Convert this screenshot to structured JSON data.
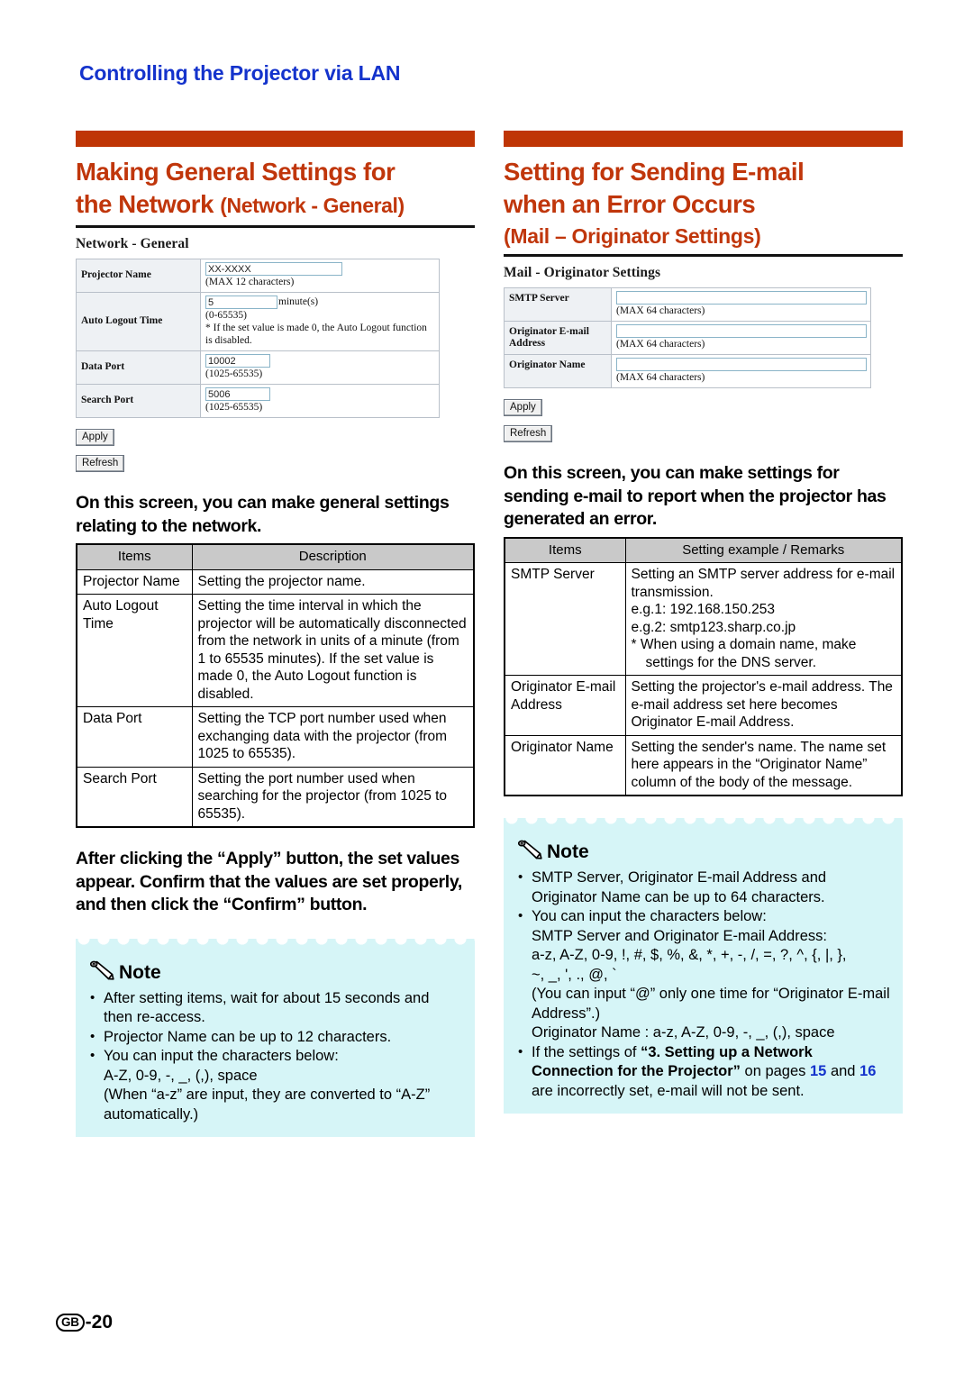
{
  "running_head": "Controlling the Projector via LAN",
  "colors": {
    "accent_orange": "#bf3505",
    "heading_blue": "#1433cc",
    "note_bg": "#d6f5f7",
    "table_header": "#c9c9c9"
  },
  "left": {
    "title_main": "Making General Settings for the Network ",
    "title_line1": "Making General Settings for",
    "title_line2": "the Network ",
    "title_sub": "(Network - General)",
    "screenshot": {
      "title": "Network - General",
      "rows": [
        {
          "label": "Projector Name",
          "value": "XX-XXXX",
          "hint": "(MAX 12 characters)"
        },
        {
          "label": "Auto Logout Time",
          "value": "5",
          "unit": "minute(s)",
          "hint": "(0-65535)",
          "hint2": "* If the set value is made 0, the Auto Logout function is disabled."
        },
        {
          "label": "Data Port",
          "value": "10002",
          "hint": "(1025-65535)"
        },
        {
          "label": "Search Port",
          "value": "5006",
          "hint": "(1025-65535)"
        }
      ],
      "apply_label": "Apply",
      "refresh_label": "Refresh"
    },
    "lead": "On this screen, you can make general settings relating to the network.",
    "table": {
      "headers": [
        "Items",
        "Description"
      ],
      "rows": [
        {
          "item": "Projector Name",
          "desc": "Setting the projector name."
        },
        {
          "item": "Auto Logout Time",
          "desc": "Setting the time interval in which the projector will be automatically disconnected from the network in units of a minute (from 1 to 65535 minutes). If the set value is made 0, the Auto Logout function is disabled."
        },
        {
          "item": "Data Port",
          "desc": "Setting the TCP port number used when exchanging data with the projector (from 1025 to 65535)."
        },
        {
          "item": "Search Port",
          "desc": "Setting the port number used when searching for the projector (from 1025 to 65535)."
        }
      ]
    },
    "lead2": "After clicking the “Apply” button, the set values appear. Confirm that the values are set properly, and then click the “Confirm” button.",
    "note": {
      "label": "Note",
      "items": [
        {
          "text": "After setting items, wait for about 15 seconds and then re-access."
        },
        {
          "text": "Projector Name can be up to 12 characters."
        },
        {
          "text": "You can input the characters below:",
          "lines": [
            "A-Z, 0-9, -, _, (,), space",
            "(When “a-z” are input, they are converted to “A-Z” automatically.)"
          ]
        }
      ]
    }
  },
  "right": {
    "title_line1": "Setting for Sending E-mail",
    "title_line2": "when an Error Occurs",
    "title_sub": "(Mail – Originator Settings)",
    "screenshot": {
      "title": "Mail - Originator Settings",
      "rows": [
        {
          "label": "SMTP Server",
          "value": "",
          "hint": "(MAX 64 characters)"
        },
        {
          "label": "Originator E-mail Address",
          "value": "",
          "hint": "(MAX 64 characters)"
        },
        {
          "label": "Originator Name",
          "value": "",
          "hint": "(MAX 64 characters)"
        }
      ],
      "apply_label": "Apply",
      "refresh_label": "Refresh"
    },
    "lead": "On this screen, you can make settings for sending e-mail to report when the projector has generated an error.",
    "table": {
      "headers": [
        "Items",
        "Setting example / Remarks"
      ],
      "rows": [
        {
          "item": "SMTP Server",
          "desc_lines": [
            "Setting an SMTP server address for e-mail transmission.",
            "e.g.1: 192.168.150.253",
            "e.g.2: smtp123.sharp.co.jp",
            "* When using a domain name, make settings for the DNS server."
          ]
        },
        {
          "item": "Originator E-mail Address",
          "desc_lines": [
            "Setting the projector's e-mail address. The e-mail address set here becomes Originator E-mail Address."
          ]
        },
        {
          "item": "Originator Name",
          "desc_lines": [
            "Setting the sender's name.  The name set here appears in the “Originator Name” column of the body of the message."
          ]
        }
      ]
    },
    "note": {
      "label": "Note",
      "item1": "SMTP Server, Originator E-mail Address and Originator Name can be up to 64 characters.",
      "item2_head": "You can input the characters below:",
      "item2_lines": [
        "SMTP Server and Originator E-mail Address:",
        "a-z, A-Z, 0-9, !, #, $, %, &, *, +, -, /, =, ?, ^, {, |, },",
        "~, _, ', ., @, `",
        "(You can input “@” only one time for “Originator E-mail Address”.)",
        "Originator Name : a-z, A-Z, 0-9, -, _, (,), space"
      ],
      "item3_pre": "If the settings of ",
      "item3_bold": "“3. Setting up a Network Connection for the Projector”",
      "item3_mid": " on pages ",
      "item3_page1": "15",
      "item3_mid2": " and ",
      "item3_page2": "16",
      "item3_post": " are incorrectly set, e-mail will not be sent."
    }
  },
  "footer": {
    "region": "GB",
    "page": "-20"
  }
}
